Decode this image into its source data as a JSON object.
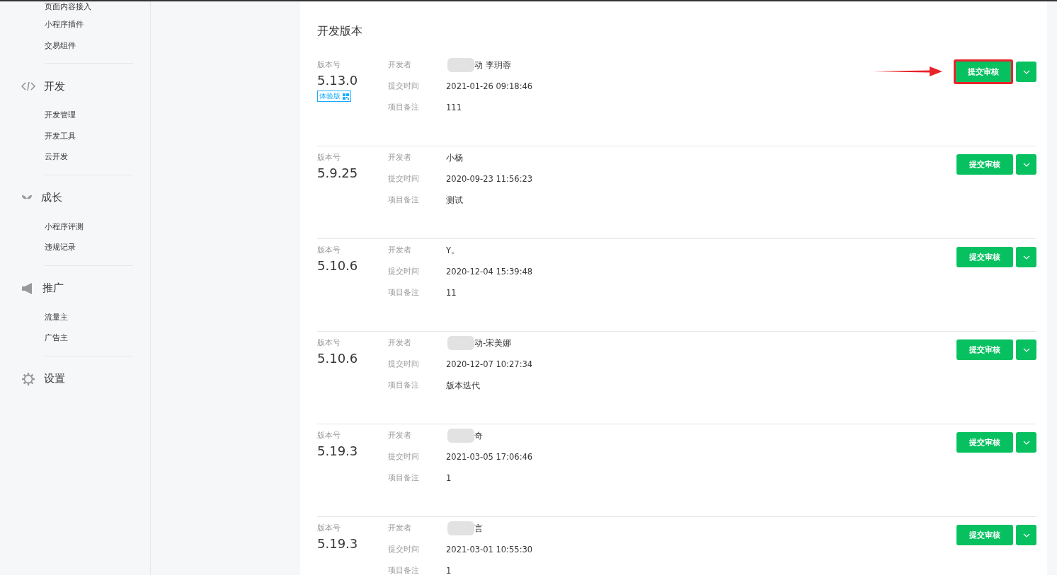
{
  "sidebar": {
    "groups": [
      {
        "items": [
          "页面内容接入",
          "小程序插件",
          "交易组件"
        ]
      },
      {
        "title": "开发",
        "items": [
          "开发管理",
          "开发工具",
          "云开发"
        ]
      },
      {
        "title": "成长",
        "items": [
          "小程序评测",
          "违规记录"
        ]
      },
      {
        "title": "推广",
        "items": [
          "流量主",
          "广告主"
        ]
      },
      {
        "title": "设置"
      }
    ]
  },
  "section_title": "开发版本",
  "versions": [
    {
      "version_label": "版本号",
      "version": "5.13.0",
      "tag": "体验版",
      "developer_label": "开发者",
      "developer": "动 李玥蓉",
      "developer_blurred": true,
      "time_label": "提交时间",
      "time": "2021-01-26 09:18:46",
      "note_label": "项目备注",
      "note": "111",
      "submit_button": "提交审核",
      "highlighted": true
    },
    {
      "version_label": "版本号",
      "version": "5.9.25",
      "developer_label": "开发者",
      "developer": "小杨",
      "developer_blurred": false,
      "time_label": "提交时间",
      "time": "2020-09-23 11:56:23",
      "note_label": "项目备注",
      "note": "测试",
      "submit_button": "提交审核",
      "highlighted": false
    },
    {
      "version_label": "版本号",
      "version": "5.10.6",
      "developer_label": "开发者",
      "developer": "Y。",
      "developer_blurred": false,
      "time_label": "提交时间",
      "time": "2020-12-04 15:39:48",
      "note_label": "项目备注",
      "note": "11",
      "submit_button": "提交审核",
      "highlighted": false
    },
    {
      "version_label": "版本号",
      "version": "5.10.6",
      "developer_label": "开发者",
      "developer": "动-宋美娜",
      "developer_blurred": true,
      "time_label": "提交时间",
      "time": "2020-12-07 10:27:34",
      "note_label": "项目备注",
      "note": "版本迭代",
      "submit_button": "提交审核",
      "highlighted": false
    },
    {
      "version_label": "版本号",
      "version": "5.19.3",
      "developer_label": "开发者",
      "developer": "奇",
      "developer_blurred": true,
      "time_label": "提交时间",
      "time": "2021-03-05 17:06:46",
      "note_label": "项目备注",
      "note": "1",
      "submit_button": "提交审核",
      "highlighted": false
    },
    {
      "version_label": "版本号",
      "version": "5.19.3",
      "developer_label": "开发者",
      "developer": "言",
      "developer_blurred": true,
      "time_label": "提交时间",
      "time": "2021-03-01 10:55:30",
      "note_label": "项目备注",
      "note": "1",
      "submit_button": "提交审核",
      "highlighted": false
    }
  ]
}
